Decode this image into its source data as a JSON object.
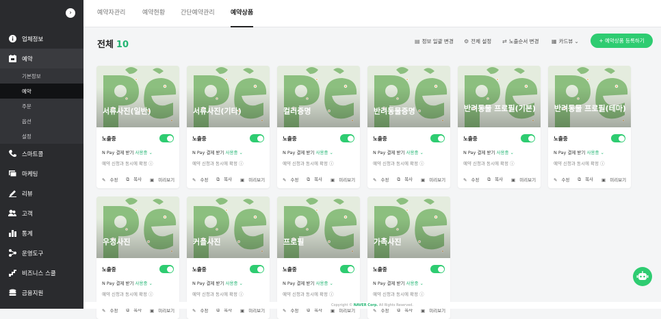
{
  "sidebar": {
    "items": [
      {
        "label": "업체정보",
        "icon": "info-icon"
      },
      {
        "label": "예약",
        "icon": "calendar-icon"
      },
      {
        "label": "스마트콜",
        "icon": "phone-icon"
      },
      {
        "label": "마케팅",
        "icon": "megaphone-icon"
      },
      {
        "label": "리뷰",
        "icon": "pencil-icon"
      },
      {
        "label": "고객",
        "icon": "people-icon"
      },
      {
        "label": "통계",
        "icon": "chart-icon"
      },
      {
        "label": "운영도구",
        "icon": "share-icon"
      },
      {
        "label": "비즈니스 스쿨",
        "icon": "stairs-icon"
      },
      {
        "label": "금융지원",
        "icon": "coins-icon"
      }
    ],
    "sub_items": [
      "기본정보",
      "예약",
      "주문",
      "옵션",
      "설정"
    ]
  },
  "tabs": [
    "예약자관리",
    "예약현황",
    "간단예약관리",
    "예약상품"
  ],
  "header": {
    "title": "전체",
    "count": "10",
    "tools": [
      "정보 일괄 변경",
      "전체 설정",
      "노출순서 변경",
      "카드뷰"
    ],
    "add_button": "+ 예약상품 등록하기"
  },
  "card_labels": {
    "status": "노출중",
    "npay_prefix": "N Pay 결제 받기",
    "npay_state": "사용중",
    "confirm": "예약 신청과 동시에 확정",
    "edit": "수정",
    "copy": "복사",
    "preview": "미리보기"
  },
  "cards": [
    {
      "name": "서류사진(일반)"
    },
    {
      "name": "서류사진(기타)"
    },
    {
      "name": "컬러증명"
    },
    {
      "name": "반려동물증명"
    },
    {
      "name": "반려동물 프로필(기본)"
    },
    {
      "name": "반려동물 프로필(테마)"
    },
    {
      "name": "우정사진"
    },
    {
      "name": "커플사진"
    },
    {
      "name": "프로필"
    },
    {
      "name": "가족사진"
    }
  ],
  "footer": {
    "prefix": "Copyright ©",
    "brand": "NAVER Corp.",
    "suffix": "All Rights Reserved."
  },
  "colors": {
    "accent": "#2ecc71",
    "sidebar": "#2a2b2e"
  }
}
